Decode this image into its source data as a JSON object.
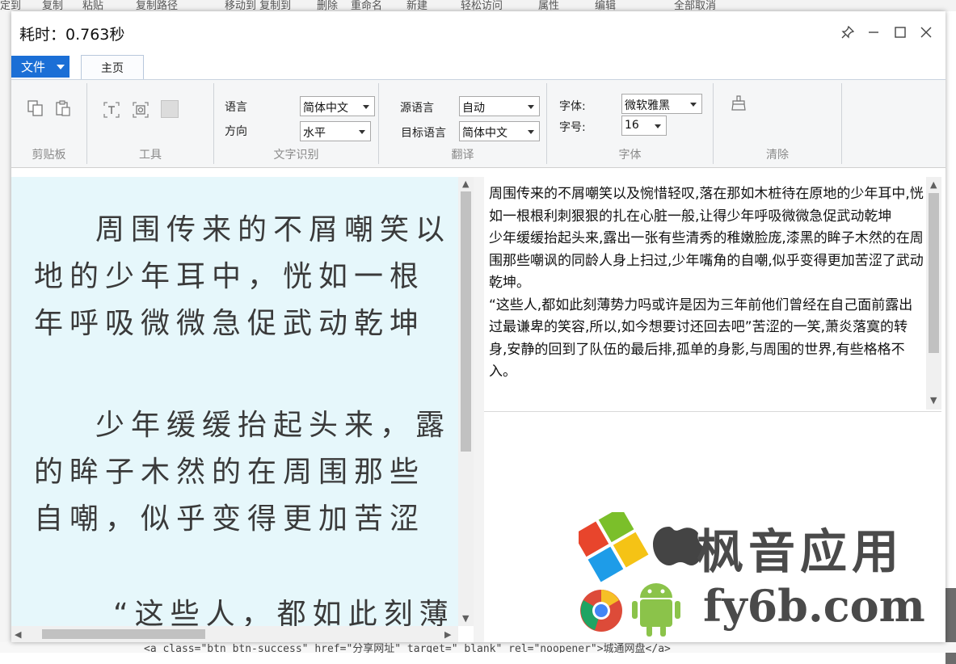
{
  "window": {
    "title": "耗时：0.763秒"
  },
  "menubar": {
    "file_label": "文件",
    "tab_home": "主页"
  },
  "ribbon": {
    "clipboard_label": "剪贴板",
    "tools_label": "工具",
    "ocr": {
      "group_label": "文字识别",
      "language_label": "语言",
      "language_value": "简体中文",
      "direction_label": "方向",
      "direction_value": "水平"
    },
    "translate": {
      "group_label": "翻译",
      "source_label": "源语言",
      "source_value": "自动",
      "target_label": "目标语言",
      "target_value": "简体中文"
    },
    "font": {
      "group_label": "字体",
      "family_label": "字体:",
      "family_value": "微软雅黑",
      "size_label": "字号:",
      "size_value": "16"
    },
    "clear_label": "清除"
  },
  "image_pane": {
    "lines": [
      "周围传来的不屑嘲笑以",
      "地的少年耳中，恍如一根",
      "年呼吸微微急促武动乾坤",
      "少年缓缓抬起头来，露",
      "的眸子木然的在周围那些",
      "自嘲，似乎变得更加苦涩",
      "“这些人，都如此刻薄"
    ]
  },
  "result": {
    "paragraphs": [
      "周围传来的不屑嘲笑以及惋惜轻叹,落在那如木桩待在原地的少年耳中,恍如一根根利刺狠狠的扎在心脏一般,让得少年呼吸微微急促武动乾坤",
      "少年缓缓抬起头来,露出一张有些清秀的稚嫩脸庞,漆黑的眸子木然的在周围那些嘲讽的同龄人身上扫过,少年嘴角的自嘲,似乎变得更加苦涩了武动乾坤。",
      "“这些人,都如此刻薄势力吗或许是因为三年前他们曾经在自己面前露出过最谦卑的笑容,所以,如今想要讨还回去吧”苦涩的一笑,萧炎落寞的转身,安静的回到了队伍的最后排,孤单的身影,与周围的世界,有些格格不入。"
    ]
  },
  "watermark": {
    "brand": "枫音应用",
    "domain": "fy6b.com"
  },
  "background": {
    "top_fragments": [
      "定到",
      "复制",
      "粘贴",
      "复制路径",
      "移动到 复制到",
      "删除",
      "重命名",
      "新建",
      "轻松访问",
      "属性",
      "编辑",
      "全部取消"
    ],
    "bottom_code": "<a class=\"btn btn-success\" href=\"分享网址\" target=\"_blank\" rel=\"noopener\">城通网盘</a>"
  },
  "colors": {
    "file_button": "#1b6fd6",
    "image_background": "#e6f7fb"
  }
}
